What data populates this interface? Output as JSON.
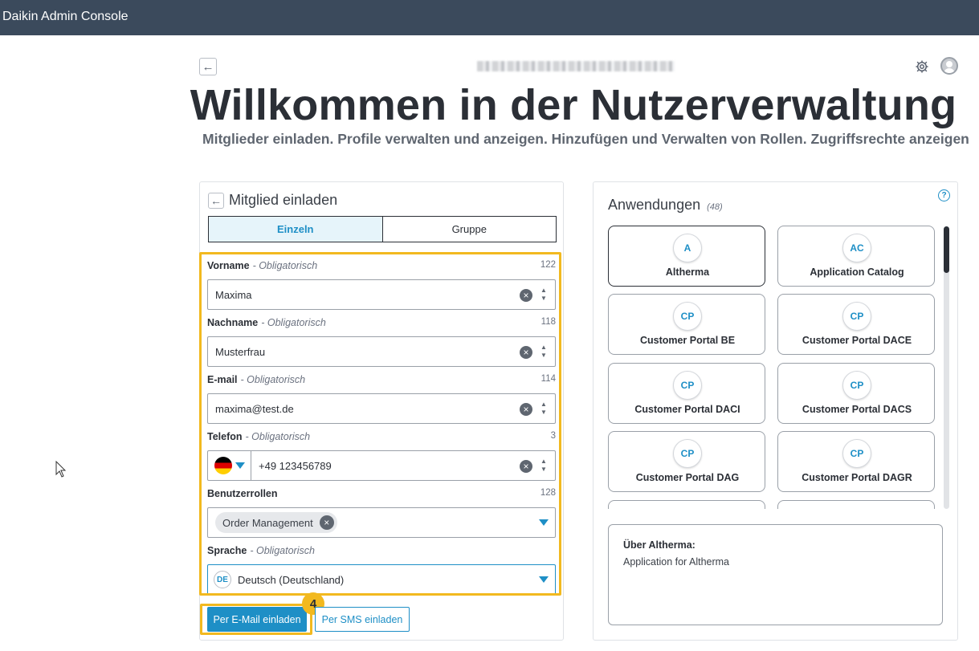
{
  "app": {
    "title": "Daikin Admin Console"
  },
  "header": {
    "heading": "Willkommen in der Nutzerverwaltung",
    "subtitle": "Mitglieder einladen. Profile verwalten und anzeigen. Hinzufügen und Verwalten von Rollen. Zugriffsrechte anzeigen"
  },
  "invite": {
    "title": "Mitglied einladen",
    "tabs": [
      {
        "label": "Einzeln",
        "active": true
      },
      {
        "label": "Gruppe",
        "active": false
      }
    ],
    "fields": {
      "firstname": {
        "label": "Vorname",
        "hint": "- Obligatorisch",
        "count": "122",
        "value": "Maxima"
      },
      "lastname": {
        "label": "Nachname",
        "hint": "- Obligatorisch",
        "count": "118",
        "value": "Musterfrau"
      },
      "email": {
        "label": "E-mail",
        "hint": "- Obligatorisch",
        "count": "114",
        "value": "maxima@test.de"
      },
      "phone": {
        "label": "Telefon",
        "hint": "- Obligatorisch",
        "count": "3",
        "value": "+49 123456789",
        "flag": "de-flag"
      },
      "roles": {
        "label": "Benutzerrollen",
        "count": "128",
        "chip": "Order Management"
      },
      "language": {
        "label": "Sprache",
        "hint": "- Obligatorisch",
        "badge": "DE",
        "value": "Deutsch (Deutschland)"
      }
    },
    "buttons": {
      "email_invite": "Per E-Mail einladen",
      "sms_invite": "Per SMS einladen",
      "step": "4"
    }
  },
  "applications": {
    "title": "Anwendungen",
    "count": "(48)",
    "items": [
      {
        "abbr": "A",
        "name": "Altherma",
        "selected": true
      },
      {
        "abbr": "AC",
        "name": "Application Catalog",
        "selected": false
      },
      {
        "abbr": "CP",
        "name": "Customer Portal BE",
        "selected": false
      },
      {
        "abbr": "CP",
        "name": "Customer Portal DACE",
        "selected": false
      },
      {
        "abbr": "CP",
        "name": "Customer Portal DACI",
        "selected": false
      },
      {
        "abbr": "CP",
        "name": "Customer Portal DACS",
        "selected": false
      },
      {
        "abbr": "CP",
        "name": "Customer Portal DAG",
        "selected": false
      },
      {
        "abbr": "CP",
        "name": "Customer Portal DAGR",
        "selected": false
      }
    ],
    "about": {
      "title": "Über Altherma:",
      "text": "Application for Altherma"
    }
  },
  "colors": {
    "accent": "#1e8fc6",
    "topbar": "#3b4a5c",
    "highlight": "#f2b91f"
  }
}
